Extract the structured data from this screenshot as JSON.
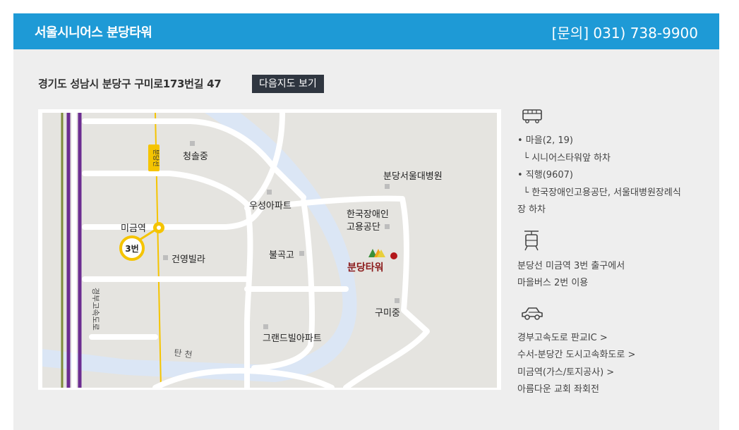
{
  "header": {
    "title": "서울시니어스 분당타워",
    "contact": "[문의] 031) 738-9900"
  },
  "address": {
    "text": "경기도 성남시 분당구 구미로173번길 47",
    "map_button": "다음지도 보기"
  },
  "map": {
    "labels": {
      "line_name": "분당선",
      "cheongsol": "청솔중",
      "bundang_hospital": "분당서울대병원",
      "useong": "우성아파트",
      "migeum": "미금역",
      "exit3": "3번",
      "disabled_corp_1": "한국장애인",
      "disabled_corp_2": "고용공단",
      "geonyoung": "건영빌라",
      "bulgok": "불곡고",
      "bundang_tower": "분당타워",
      "expressway": "경부고속도로",
      "gumi": "구미중",
      "grand": "그랜드빌아파트",
      "tancheon": "탄 천"
    }
  },
  "transport": {
    "bus": {
      "icon": "bus-icon",
      "lines": [
        "• 마을(2, 19)",
        "  └ 시니어스타워앞 하차",
        "• 직행(9607)",
        "  └ 한국장애인고용공단, 서울대병원장례식",
        "장 하차"
      ]
    },
    "subway": {
      "icon": "subway-icon",
      "lines": [
        "분당선 미금역 3번 출구에서",
        "마을버스 2번 이용"
      ]
    },
    "car": {
      "icon": "car-icon",
      "lines": [
        "경부고속도로 판교IC >",
        "수서-분당간 도시고속화도로 >",
        "미금역(가스/토지공사) >",
        "아름다운 교회 좌회전"
      ]
    }
  },
  "colors": {
    "header_bg": "#1e9ad6",
    "river": "#dbe6f5",
    "road": "#ffffff",
    "land": "#e5e4e0",
    "line_purple": "#6c2d91",
    "line_olive": "#7d8a3a",
    "line_yellow": "#f5c400",
    "marker_red": "#b3171b"
  }
}
